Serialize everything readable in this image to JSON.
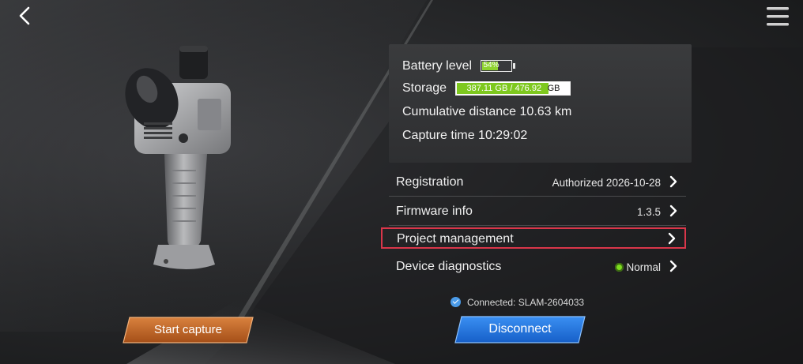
{
  "info": {
    "battery_label": "Battery level",
    "battery_value": "54%",
    "battery_fraction": 0.54,
    "storage_label": "Storage",
    "storage_used": "387.11 GB / 476.92",
    "storage_unit": "GB",
    "storage_fraction": 0.81,
    "distance_label": "Cumulative distance",
    "distance_value": "10.63 km",
    "capture_label": "Capture time",
    "capture_value": "10:29:02"
  },
  "menu": [
    {
      "label": "Registration",
      "value": "Authorized 2026-10-28"
    },
    {
      "label": "Firmware info",
      "value": "1.3.5"
    },
    {
      "label": "Project management",
      "value": ""
    },
    {
      "label": "Device diagnostics",
      "value": "Normal"
    }
  ],
  "connection": {
    "text": "Connected: SLAM-2604033"
  },
  "buttons": {
    "start_capture": "Start capture",
    "disconnect": "Disconnect"
  },
  "colors": {
    "battery_green": "#8ed32f",
    "status_green": "#8fdc2c",
    "start_button": "#c8692a",
    "disconnect_button": "#1f78e6",
    "highlight_border": "#d9364a",
    "check_blue": "#4a9be8"
  },
  "icons": {
    "back": "chevron-left-icon",
    "menu": "hamburger-menu-icon",
    "row_arrow": "chevron-right-icon",
    "connected": "check-circle-icon",
    "status": "status-dot-icon"
  }
}
